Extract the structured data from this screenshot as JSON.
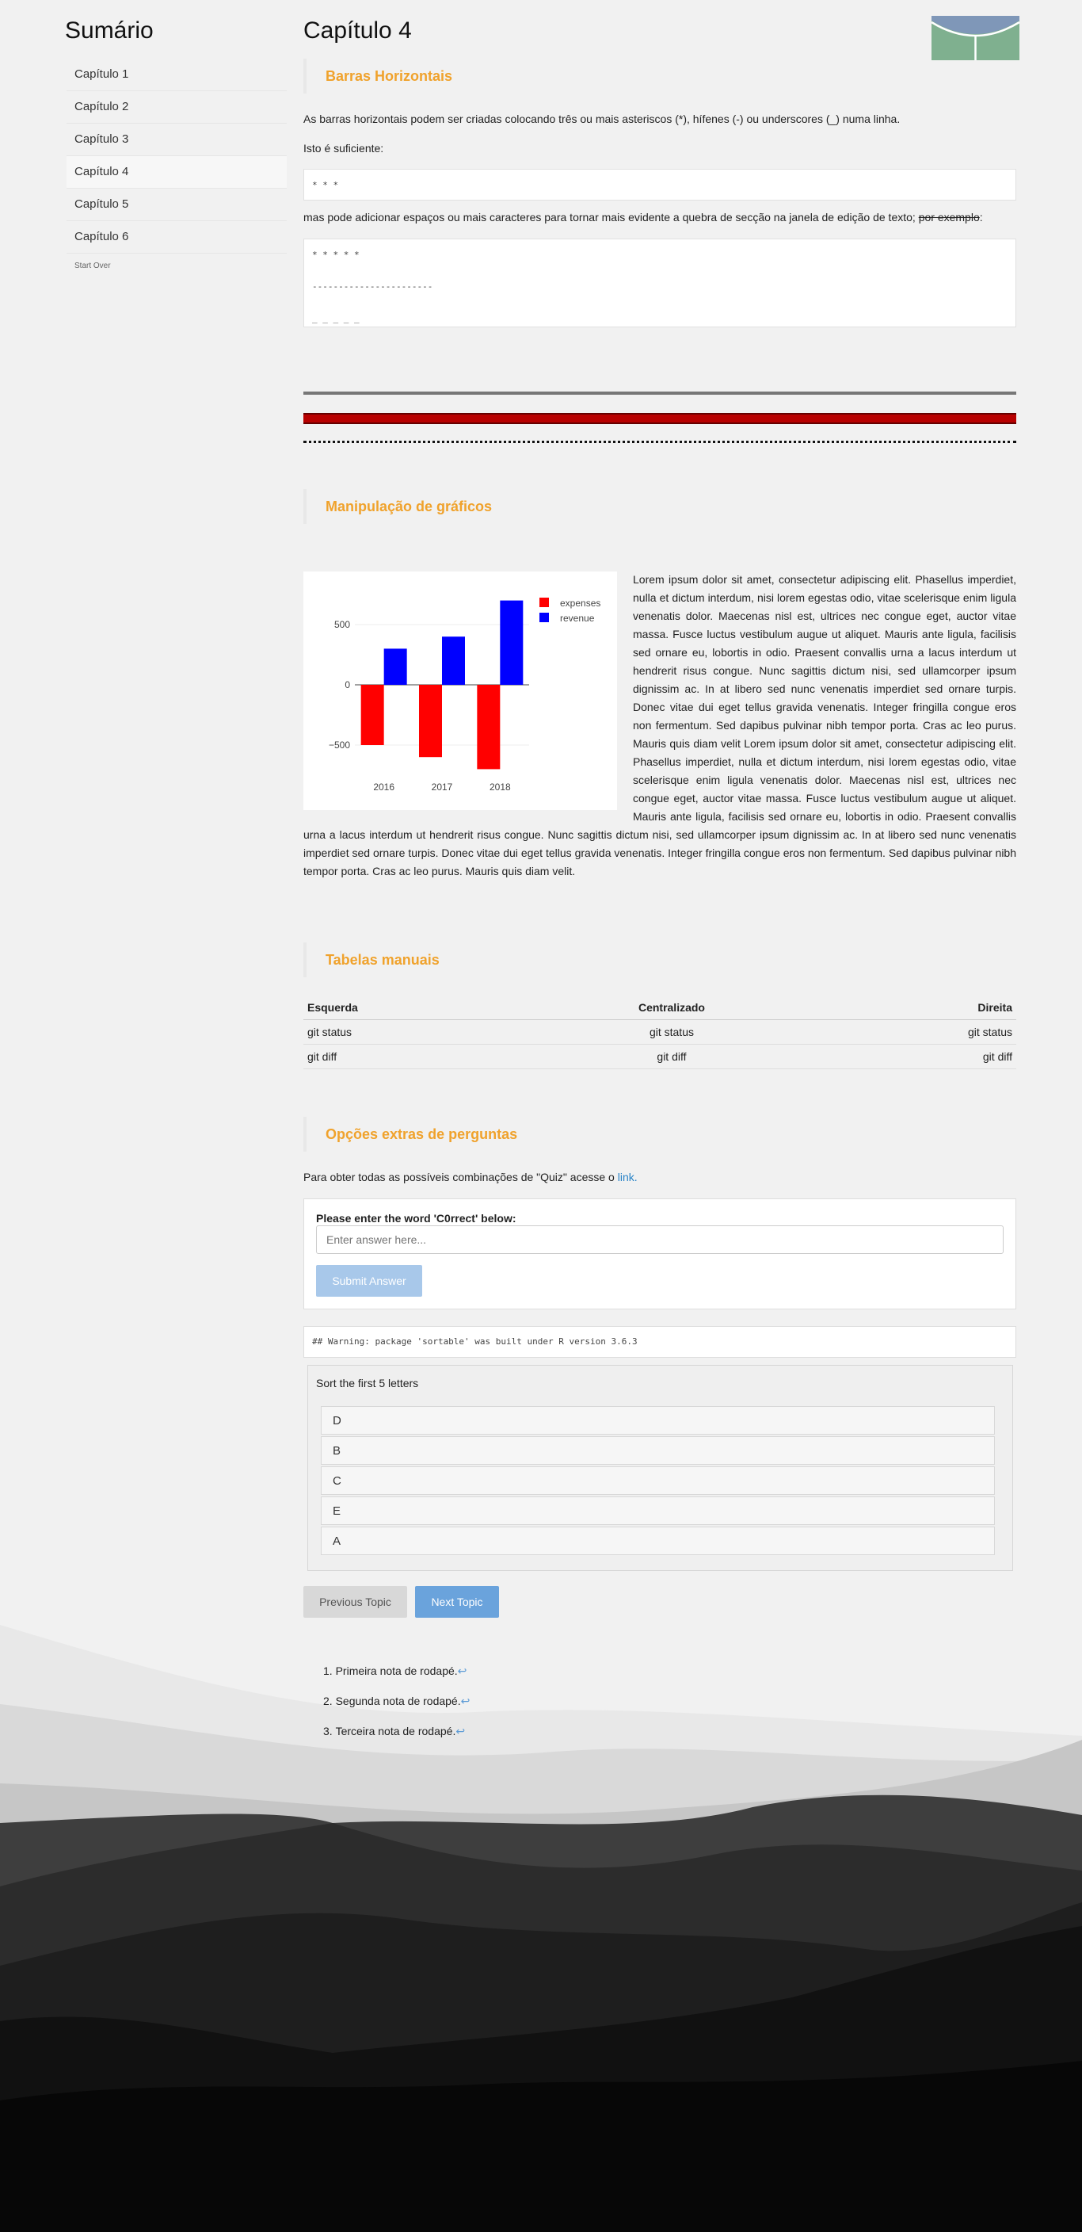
{
  "sidebar": {
    "title": "Sumário",
    "items": [
      {
        "label": "Capítulo 1"
      },
      {
        "label": "Capítulo 2"
      },
      {
        "label": "Capítulo 3"
      },
      {
        "label": "Capítulo 4",
        "active": true
      },
      {
        "label": "Capítulo 5"
      },
      {
        "label": "Capítulo 6"
      }
    ],
    "start_over": "Start Over"
  },
  "main": {
    "chapter_title": "Capítulo 4",
    "logo_icon": "unb-logo-icon",
    "sections": {
      "horizontal_bars": {
        "title": "Barras Horizontais",
        "intro": "As barras horizontais podem ser criadas colocando três ou mais asteriscos (*), hífenes (-) ou underscores (_) numa linha.",
        "enough": "Isto é suficiente:",
        "code1": "* * *",
        "more_a": "mas pode adicionar espaços ou mais caracteres para tornar mais evidente a quebra de secção na janela de edição de texto;",
        "more_strike": "por exemplo",
        "more_end": ":",
        "code2": [
          "* * * * *",
          "-----------------------",
          "_ _ _ _ _"
        ]
      },
      "graphics": {
        "title": "Manipulação de gráficos"
      },
      "tables": {
        "title": "Tabelas manuais"
      },
      "quiz": {
        "title": "Opções extras de perguntas"
      }
    },
    "lorem": "Lorem ipsum dolor sit amet, consectetur adipiscing elit. Phasellus imperdiet, nulla et dictum interdum, nisi lorem egestas odio, vitae scelerisque enim ligula venenatis dolor. Maecenas nisl est, ultrices nec congue eget, auctor vitae massa. Fusce luctus vestibulum augue ut aliquet. Mauris ante ligula, facilisis sed ornare eu, lobortis in odio. Praesent convallis urna a lacus interdum ut hendrerit risus congue. Nunc sagittis dictum nisi, sed ullamcorper ipsum dignissim ac. In at libero sed nunc venenatis imperdiet sed ornare turpis. Donec vitae dui eget tellus gravida venenatis. Integer fringilla congue eros non fermentum. Sed dapibus pulvinar nibh tempor porta. Cras ac leo purus. Mauris quis diam velit Lorem ipsum dolor sit amet, consectetur adipiscing elit. Phasellus imperdiet, nulla et dictum interdum, nisi lorem egestas odio, vitae scelerisque enim ligula venenatis dolor. Maecenas nisl est, ultrices nec congue eget, auctor vitae massa. Fusce luctus vestibulum augue ut aliquet. Mauris ante ligula, facilisis sed ornare eu, lobortis in odio. Praesent convallis urna a lacus interdum ut hendrerit risus congue. Nunc sagittis dictum nisi, sed ullamcorper ipsum dignissim ac. In at libero sed nunc venenatis imperdiet sed ornare turpis. Donec vitae dui eget tellus gravida venenatis. Integer fringilla congue eros non fermentum. Sed dapibus pulvinar nibh tempor porta. Cras ac leo purus. Mauris quis diam velit.",
    "table": {
      "headers": [
        "Esquerda",
        "Centralizado",
        "Direita"
      ],
      "rows": [
        [
          "git status",
          "git status",
          "git status"
        ],
        [
          "git diff",
          "git diff",
          "git diff"
        ]
      ]
    },
    "quiz": {
      "intro": "Para obter todas as possíveis combinações de \"Quiz\" acesse o",
      "link_text": "link.",
      "question": "Please enter the word 'C0rrect' below:",
      "placeholder": "Enter answer here...",
      "submit": "Submit Answer",
      "warning": "## Warning: package 'sortable' was built under R version 3.6.3",
      "sort_label": "Sort the first 5 letters",
      "sort_items": [
        "D",
        "B",
        "C",
        "E",
        "A"
      ]
    },
    "nav": {
      "previous": "Previous Topic",
      "next": "Next Topic"
    },
    "footnotes": [
      {
        "text": "Primeira nota de rodapé.",
        "back": "↩"
      },
      {
        "text": "Segunda nota de rodapé.",
        "back": "↩"
      },
      {
        "text": "Terceira nota de rodapé.",
        "back": "↩"
      }
    ]
  },
  "chart_data": {
    "type": "bar",
    "categories": [
      "2016",
      "2017",
      "2018"
    ],
    "series": [
      {
        "name": "expenses",
        "values": [
          -500,
          -600,
          -700
        ],
        "color": "#ff0000"
      },
      {
        "name": "revenue",
        "values": [
          300,
          400,
          700
        ],
        "color": "#0000ff"
      }
    ],
    "y_ticks": [
      500,
      0,
      -500
    ],
    "y_tick_labels": [
      "500",
      "0",
      "−500"
    ],
    "ylim": [
      -750,
      750
    ],
    "legend": "top-right"
  },
  "colors": {
    "accent": "#f0a22c",
    "link": "#2a84c8",
    "next_button": "#6aa3dc"
  }
}
